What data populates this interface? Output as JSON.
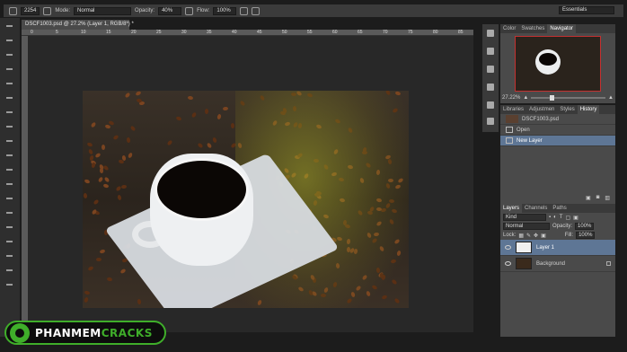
{
  "options_bar": {
    "brush_size": "2254",
    "mode_label": "Mode:",
    "mode_value": "Normal",
    "opacity_label": "Opacity:",
    "opacity_value": "40%",
    "flow_label": "Flow:",
    "flow_value": "100%",
    "workspace": "Essentials"
  },
  "document": {
    "tab_title": "DSCF1003.psd @ 27.2% (Layer 1, RGB/8*) *",
    "ruler_marks": [
      "0",
      "5",
      "10",
      "15",
      "20",
      "25",
      "30",
      "35",
      "40",
      "45",
      "50",
      "55",
      "60",
      "65",
      "70",
      "75",
      "80",
      "85"
    ]
  },
  "navigator_panel": {
    "tabs": [
      "Color",
      "Swatches",
      "Navigator"
    ],
    "active_tab": "Navigator",
    "zoom": "27.22%"
  },
  "history_panel": {
    "tabs": [
      "Libraries",
      "Adjustmen",
      "Styles",
      "History"
    ],
    "active_tab": "History",
    "snapshot": "DSCF1003.psd",
    "states": [
      {
        "label": "Open",
        "selected": false
      },
      {
        "label": "New Layer",
        "selected": true
      }
    ]
  },
  "layers_panel": {
    "tabs": [
      "Layers",
      "Channels",
      "Paths"
    ],
    "active_tab": "Layers",
    "filter_kind": "Kind",
    "blend_mode": "Normal",
    "opacity_label": "Opacity:",
    "opacity_value": "100%",
    "lock_label": "Lock:",
    "fill_label": "Fill:",
    "fill_value": "100%",
    "layers": [
      {
        "name": "Layer 1",
        "selected": true
      },
      {
        "name": "Background",
        "selected": false
      }
    ]
  },
  "watermark": {
    "text_white": "PHANMEM",
    "text_green": "CRACKS"
  },
  "colors": {
    "accent_selection": "#5e7695",
    "logo_green": "#3fae2a",
    "navigator_frame": "#c43030"
  }
}
